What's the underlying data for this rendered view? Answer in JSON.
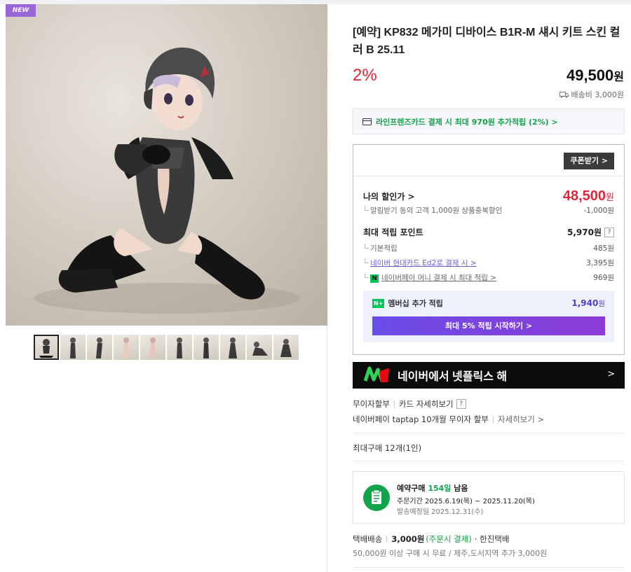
{
  "gallery": {
    "badge": "NEW",
    "thumbnail_count": 10,
    "selected_thumbnail": 1
  },
  "product": {
    "title": "[예약] KP832 메가미 디바이스 B1R-M 섀시 키트 스킨 컬러 B 25.11",
    "discount_rate": "2%",
    "price": "49,500",
    "price_unit": "원",
    "shipping_fee": "배송비 3,000원"
  },
  "card_banner": {
    "text": "라인프렌즈카드 결제 시 최대 970원 추가적립 (2%) >"
  },
  "benefits": {
    "coupon_button": "쿠폰받기 >",
    "my_price_label": "나의 할인가 >",
    "my_price_value": "48,500",
    "my_price_unit": "원",
    "alert_discount_label": "알림받기 동의 고객 1,000원 상품중복할인",
    "alert_discount_value": "-1,000원",
    "max_points_label": "최대 적립 포인트",
    "max_points_value": "5,970원",
    "help_glyph": "?",
    "basic_points_label": "기본적립",
    "basic_points_value": "485원",
    "hyundai_card_label": "네이버 현대카드 Ed2로 결제 시 >",
    "hyundai_card_value": "3,395원",
    "naverpay_money_label": "네이버페이 머니 결제 시 최대 적립 >",
    "naverpay_money_value": "969원",
    "npay_glyph": "N",
    "membership_badge": "N+",
    "membership_label": "멤버십 추가 적립",
    "membership_value": "1,940",
    "membership_unit": "원",
    "membership_button": "최대 5% 적립 시작하기 >"
  },
  "netflix_banner": {
    "text": "네이버에서 넷플릭스 해",
    "arrow": ">"
  },
  "installment": {
    "label": "무이자할부",
    "card_link": "카드 자세히보기",
    "help_glyph": "?",
    "taptap_text": "네이버페이 taptap 10개월 무이자 할부",
    "taptap_link": "자세히보기 >"
  },
  "purchase_limit": "최대구매 12개(1인)",
  "preorder": {
    "title_prefix": "예약구매",
    "days": "154일",
    "title_suffix": "남음",
    "order_period": "주문기간  2025.6.19(목) ~ 2025.11.20(목)",
    "ship_date": "발송예정일  2025.12.31(수)"
  },
  "delivery": {
    "method": "택배배송",
    "fee": "3,000원",
    "fee_note": "(주문시 결제)",
    "courier": "· 한진택배",
    "note": "50,000원 이상 구매 시 무료 / 제주,도서지역 추가 3,000원"
  },
  "colors": {
    "discount_red": "#e0263a",
    "naver_green": "#13a34a",
    "membership_purple": "#6a4de8"
  }
}
